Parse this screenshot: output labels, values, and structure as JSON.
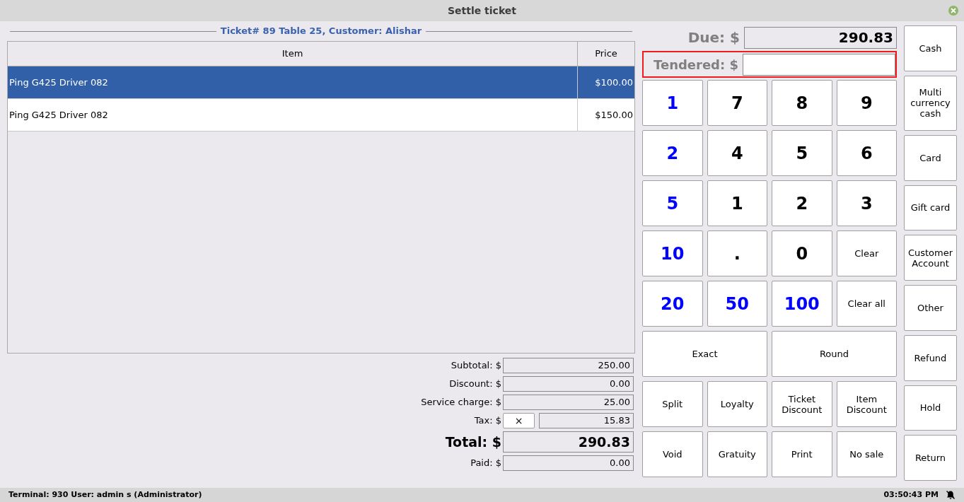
{
  "window": {
    "title": "Settle ticket"
  },
  "ticket_header": "Ticket# 89 Table 25, Customer: Alishar",
  "table": {
    "columns": [
      "Item",
      "Price"
    ],
    "rows": [
      {
        "item": "Ping G425 Driver 082",
        "price": "$100.00",
        "selected": true
      },
      {
        "item": "Ping G425 Driver 082",
        "price": "$150.00",
        "selected": false
      }
    ]
  },
  "totals": [
    {
      "kind": "plain",
      "label": "Subtotal: $",
      "value": "250.00"
    },
    {
      "kind": "plain",
      "label": "Discount: $",
      "value": "0.00"
    },
    {
      "kind": "plain",
      "label": "Service charge: $",
      "value": "25.00"
    },
    {
      "kind": "tax",
      "label": "Tax: $",
      "button": "×",
      "value": "15.83"
    },
    {
      "kind": "total",
      "label": "Total: $",
      "value": "290.83"
    },
    {
      "kind": "plain",
      "label": "Paid: $",
      "value": "0.00"
    }
  ],
  "due": {
    "label": "Due: $",
    "value": "290.83"
  },
  "tendered": {
    "label": "Tendered: $",
    "highlighted": true
  },
  "keypad": [
    [
      {
        "label": "1",
        "kind": "quick"
      },
      {
        "label": "7",
        "kind": "digit"
      },
      {
        "label": "8",
        "kind": "digit"
      },
      {
        "label": "9",
        "kind": "digit"
      }
    ],
    [
      {
        "label": "2",
        "kind": "quick"
      },
      {
        "label": "4",
        "kind": "digit"
      },
      {
        "label": "5",
        "kind": "digit"
      },
      {
        "label": "6",
        "kind": "digit"
      }
    ],
    [
      {
        "label": "5",
        "kind": "quick"
      },
      {
        "label": "1",
        "kind": "digit"
      },
      {
        "label": "2",
        "kind": "digit"
      },
      {
        "label": "3",
        "kind": "digit"
      }
    ],
    [
      {
        "label": "10",
        "kind": "quick"
      },
      {
        "label": ".",
        "kind": "digit"
      },
      {
        "label": "0",
        "kind": "digit"
      },
      {
        "label": "Clear",
        "kind": "action"
      }
    ],
    [
      {
        "label": "20",
        "kind": "quick"
      },
      {
        "label": "50",
        "kind": "quick"
      },
      {
        "label": "100",
        "kind": "quick"
      },
      {
        "label": "Clear all",
        "kind": "action"
      }
    ],
    [
      {
        "label": "Exact",
        "kind": "wide"
      },
      {
        "label": "Round",
        "kind": "wide"
      }
    ],
    [
      {
        "label": "Split",
        "kind": "action"
      },
      {
        "label": "Loyalty",
        "kind": "action"
      },
      {
        "label": "Ticket Discount",
        "kind": "action"
      },
      {
        "label": "Item Discount",
        "kind": "action"
      }
    ],
    [
      {
        "label": "Void",
        "kind": "action"
      },
      {
        "label": "Gratuity",
        "kind": "action"
      },
      {
        "label": "Print",
        "kind": "action"
      },
      {
        "label": "No sale",
        "kind": "action"
      }
    ]
  ],
  "payment_buttons": [
    "Cash",
    "Multi currency cash",
    "Card",
    "Gift card",
    "Customer Account",
    "Other",
    "Refund",
    "Hold",
    "Return"
  ],
  "status_bar": {
    "terminal": "Terminal: 930 User: admin s (Administrator)",
    "time": "03:50:43 PM"
  }
}
